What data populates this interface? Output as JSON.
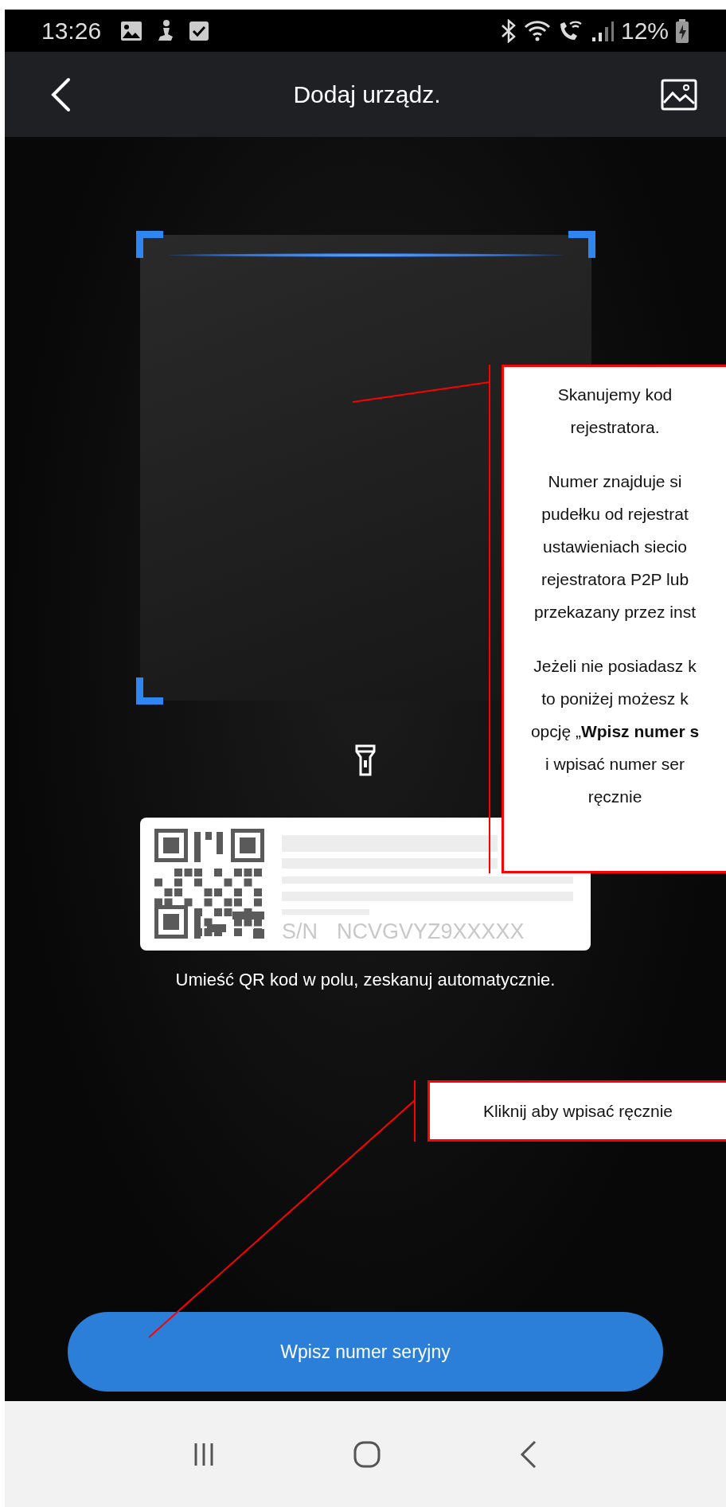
{
  "status_bar": {
    "time": "13:26",
    "battery": "12%"
  },
  "app_bar": {
    "title": "Dodaj urządz."
  },
  "scanner": {
    "serial_prefix": "S/N",
    "serial_number": "NCVGVYZ9XXXXX",
    "hint": "Umieść QR kod w polu, zeskanuj automatycznie."
  },
  "button": {
    "label": "Wpisz numer seryjny"
  },
  "annotations": [
    {
      "paragraphs": [
        [
          "Skanujemy kod",
          "rejestratora."
        ],
        [
          "Numer znajduje si",
          "pudełku od rejestrat",
          "ustawieniach siecio",
          "rejestratora P2P lub",
          "przekazany przez inst"
        ],
        [
          "Jeżeli nie posiadasz k",
          "to poniżej możesz k",
          "opcję „**Wpisz numer s**",
          "i wpisać numer ser",
          "ręcznie"
        ]
      ]
    },
    {
      "paragraphs": [
        [
          "Kliknij aby wpisać ręcznie"
        ]
      ]
    }
  ]
}
